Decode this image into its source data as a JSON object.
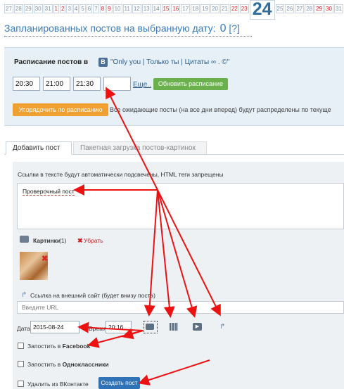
{
  "date_strip": {
    "days": [
      {
        "label": "27",
        "red": false
      },
      {
        "label": "28",
        "red": false
      },
      {
        "label": "29",
        "red": false
      },
      {
        "label": "30",
        "red": false
      },
      {
        "label": "31",
        "red": false
      },
      {
        "label": "1",
        "red": true
      },
      {
        "label": "2",
        "red": true
      },
      {
        "label": "3",
        "red": false
      },
      {
        "label": "4",
        "red": false
      },
      {
        "label": "5",
        "red": false
      },
      {
        "label": "6",
        "red": false
      },
      {
        "label": "7",
        "red": false
      },
      {
        "label": "8",
        "red": true
      },
      {
        "label": "9",
        "red": true
      },
      {
        "label": "10",
        "red": false
      },
      {
        "label": "11",
        "red": false
      },
      {
        "label": "12",
        "red": false
      },
      {
        "label": "13",
        "red": false
      },
      {
        "label": "14",
        "red": false
      },
      {
        "label": "15",
        "red": true
      },
      {
        "label": "16",
        "red": true
      },
      {
        "label": "17",
        "red": false
      },
      {
        "label": "18",
        "red": false
      },
      {
        "label": "19",
        "red": false
      },
      {
        "label": "20",
        "red": false
      },
      {
        "label": "21",
        "red": false
      },
      {
        "label": "22",
        "red": true
      },
      {
        "label": "23",
        "red": true
      },
      {
        "label": "24",
        "selected": true
      },
      {
        "label": "25",
        "red": false
      },
      {
        "label": "26",
        "red": false
      },
      {
        "label": "27",
        "red": false
      },
      {
        "label": "28",
        "red": false
      },
      {
        "label": "29",
        "red": true
      },
      {
        "label": "30",
        "red": true
      },
      {
        "label": "31",
        "red": false
      }
    ]
  },
  "planned": {
    "title": "Запланированных постов на выбранную дату:",
    "count": "0",
    "help": "[?]"
  },
  "schedule": {
    "title": "Расписание постов в",
    "vk_icon": "В",
    "group_name": "\"Only you | Только ты | Цитаты ∞ . ©\"",
    "times": [
      "20:30",
      "21:00",
      "21:30",
      ""
    ],
    "more_link": "Еще..",
    "update_button": "Обновить расписание",
    "order_button": "Упорядочить по расписанию",
    "order_note": "Все ожидающие посты (на все дни вперед) будут распределены по текуще"
  },
  "tabs": {
    "add_post": "Добавить пост",
    "batch_upload": "Пакетная загрузка постов-картинок"
  },
  "form": {
    "links_note": "Ссылки в тексте будут автоматически подсвечены, HTML теги запрещены",
    "post_text": "Проверочный пост",
    "images_label": "Картинки",
    "images_count": "(1)",
    "remove_label": "Убрать",
    "link_label": "Ссылка на внешний сайт (будет внизу поста)",
    "url_placeholder": "Введите URL",
    "date_label": "Дата",
    "date_value": "2015-08-24",
    "time_label": "Время",
    "time_value": "20:16",
    "facebook_prefix": "Запостить в",
    "facebook_name": "Facebook",
    "ok_prefix": "Запостить в",
    "ok_name": "Одноклассники",
    "delete_label": "Удалить из ВКонтакте",
    "create_button": "Создать пост"
  },
  "colors": {
    "accent": "#2f72b5",
    "arrow": "#ee1111",
    "update_green": "#6ab04c",
    "order_orange": "#f0a030",
    "weekend_red": "#cc1f1f"
  },
  "icons": [
    "camera-icon",
    "film-icon",
    "video-icon",
    "link-icon",
    "vk-icon",
    "close-icon"
  ]
}
